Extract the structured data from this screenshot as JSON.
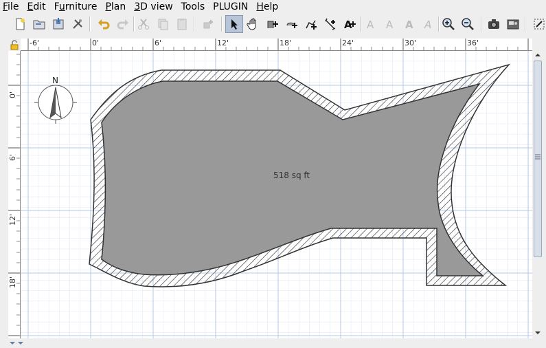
{
  "menubar": {
    "items": [
      {
        "label": "File",
        "u": "F"
      },
      {
        "label": "Edit",
        "u": "E"
      },
      {
        "label": "Furniture",
        "u": "u"
      },
      {
        "label": "Plan",
        "u": "P"
      },
      {
        "label": "3D view",
        "u": "3"
      },
      {
        "label": "Tools",
        "u": ""
      },
      {
        "label": "PLUGIN",
        "u": ""
      },
      {
        "label": "Help",
        "u": "H"
      }
    ]
  },
  "rulers": {
    "top_labels": [
      "-6'",
      "0'",
      "6'",
      "12'",
      "18'",
      "24'",
      "30'",
      "36'"
    ],
    "left_labels": [
      "0'",
      "6'",
      "12'",
      "18'"
    ]
  },
  "plan": {
    "room_area_label": "518 sq ft",
    "compass_label": "N"
  },
  "colors": {
    "room_fill": "#999999",
    "wall_stroke": "#333333",
    "grid_major": "#b4c8e6",
    "grid_minor": "#dde6f3",
    "selected_tool_bg": "#b8c4d8"
  },
  "toolbar": {
    "icons": [
      "new-file-icon",
      "open-icon",
      "save-icon",
      "preferences-icon",
      "undo-icon",
      "redo-icon",
      "cut-icon",
      "copy-icon",
      "paste-icon",
      "add-furniture-icon",
      "select-mode-icon",
      "pan-mode-icon",
      "create-walls-icon",
      "create-rooms-icon",
      "create-polylines-icon",
      "create-dimensions-icon",
      "add-text-icon",
      "text-style-1-icon",
      "text-style-2-icon",
      "text-bold-icon",
      "text-italic-icon",
      "zoom-in-icon",
      "zoom-out-icon",
      "create-photo-icon",
      "create-video-icon",
      "more-icon"
    ],
    "active": "select-mode-icon"
  }
}
